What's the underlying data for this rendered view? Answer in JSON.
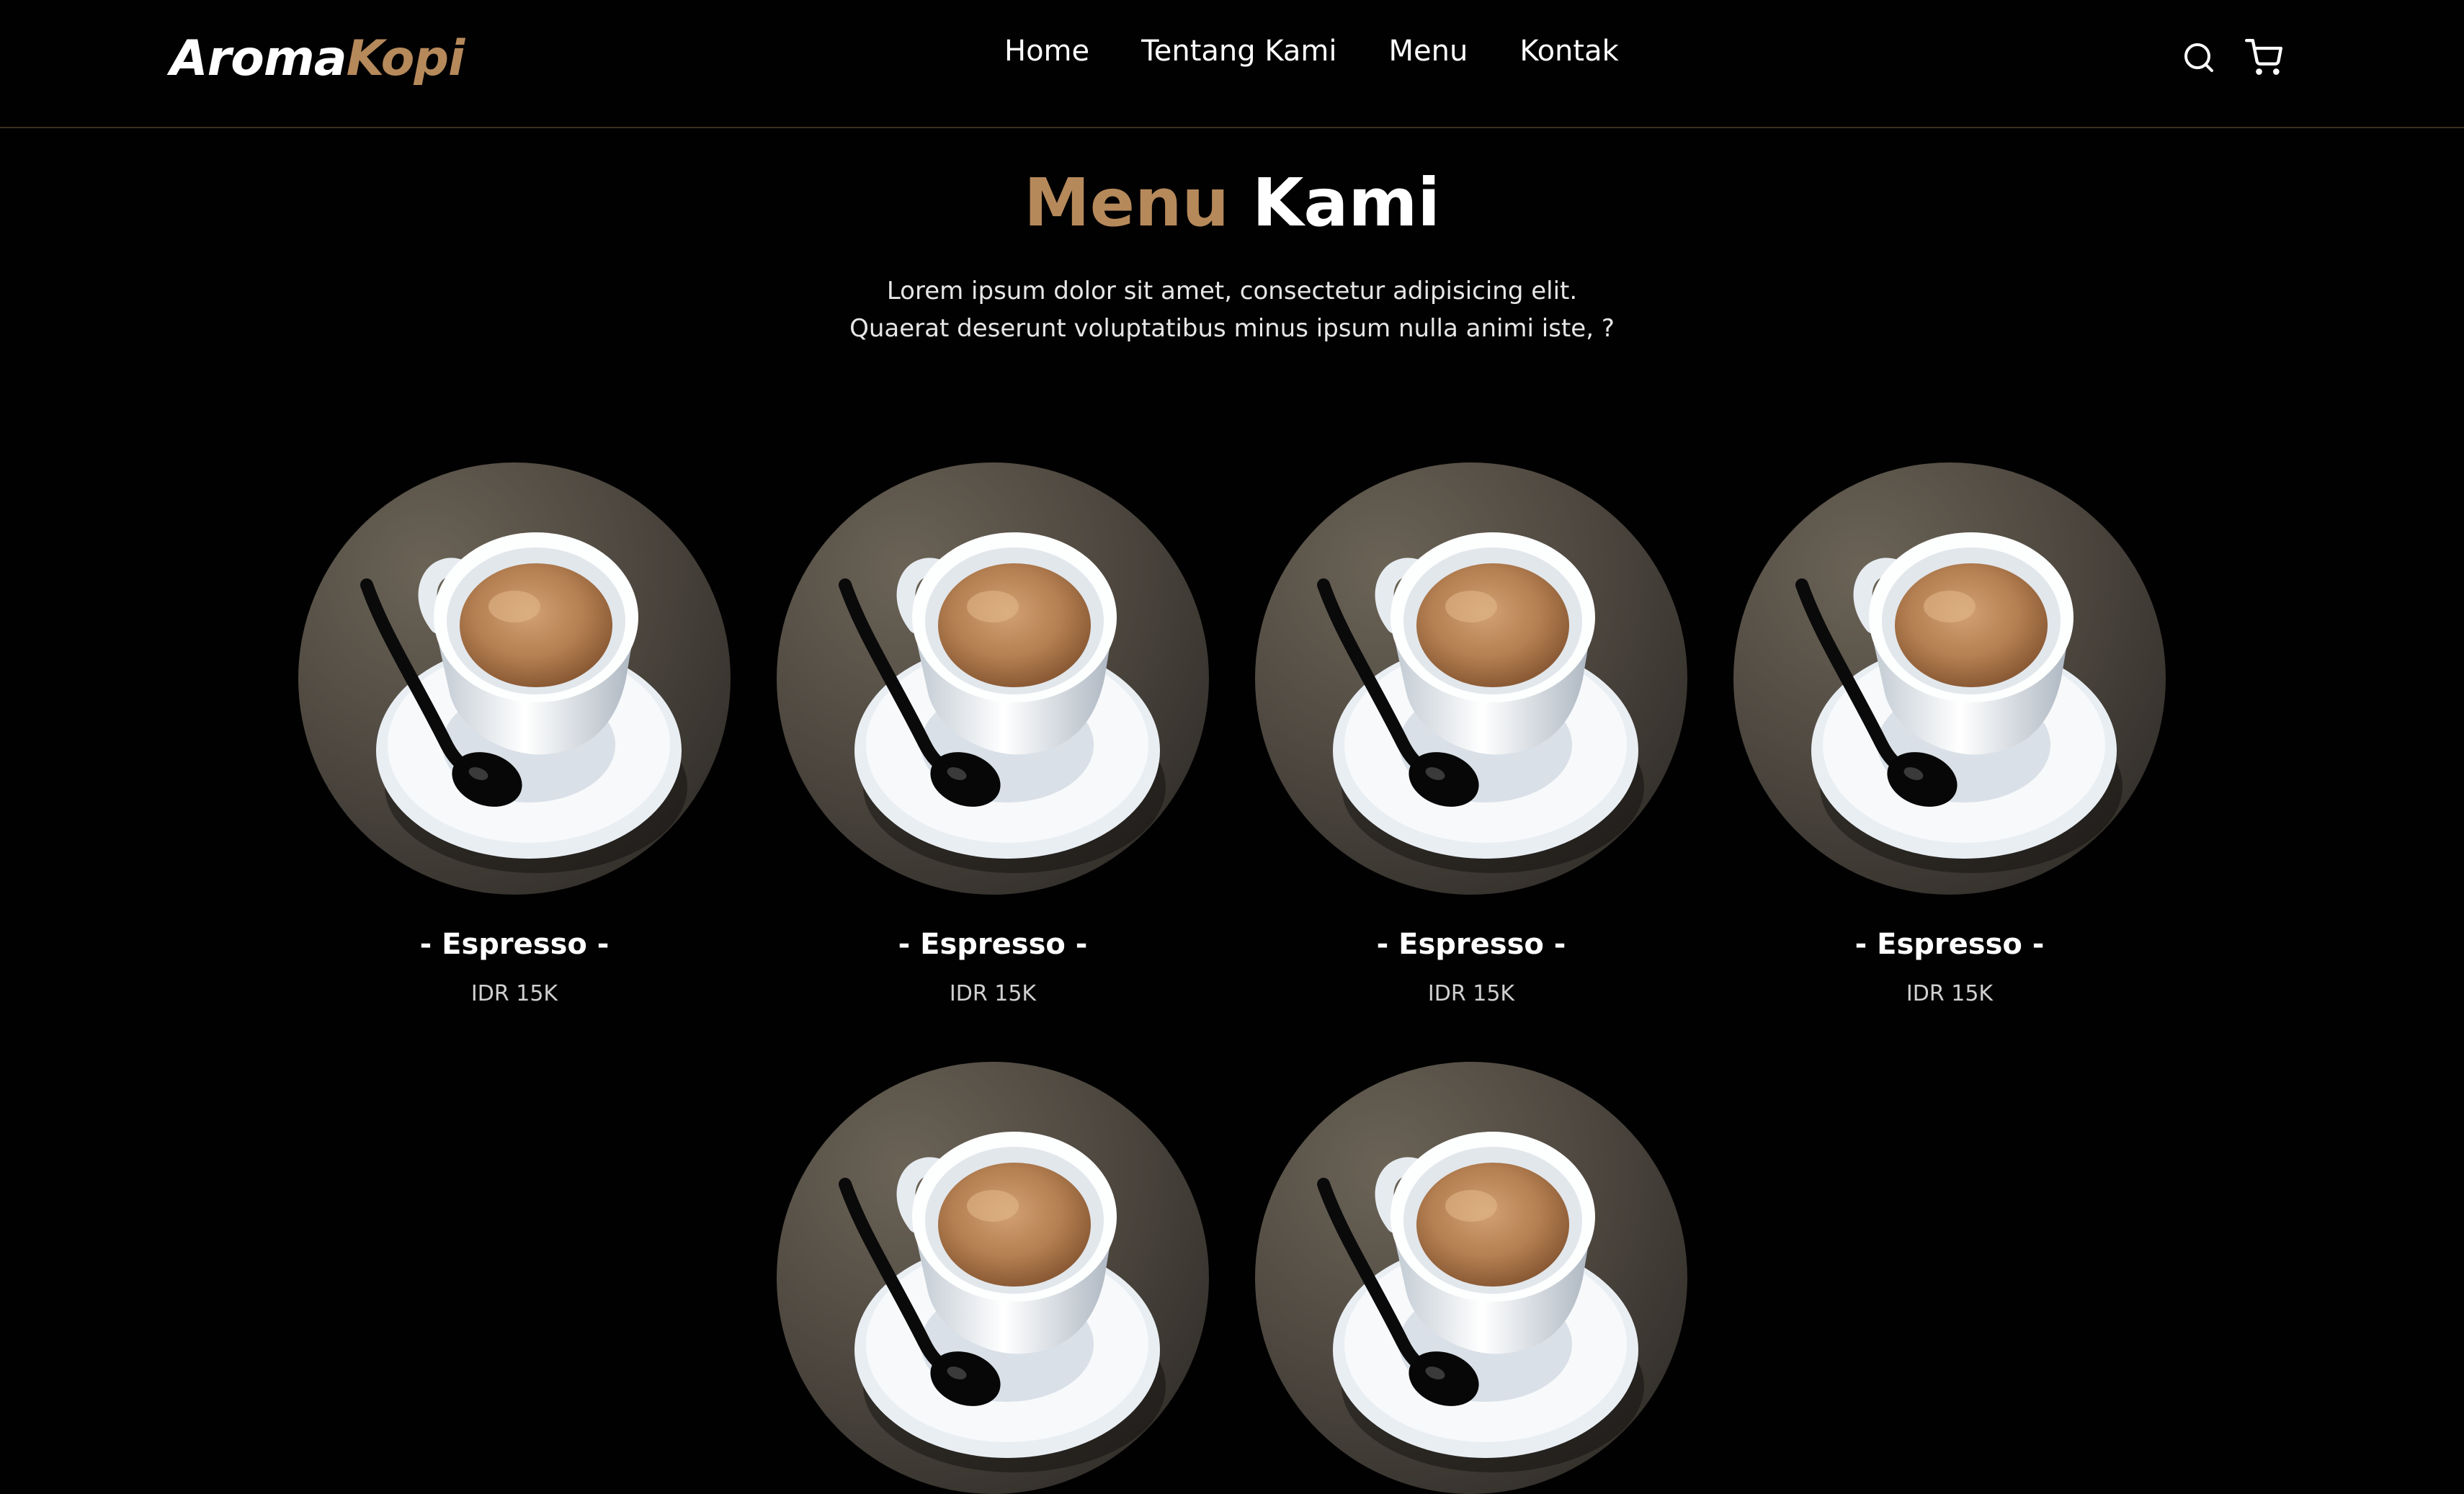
{
  "brand": {
    "part1": "Aroma",
    "part2": "Kopi"
  },
  "nav": {
    "links": [
      "Home",
      "Tentang Kami",
      "Menu",
      "Kontak"
    ],
    "icons": [
      "search-icon",
      "cart-icon"
    ]
  },
  "section": {
    "title_accent": "Menu",
    "title_rest": "Kami",
    "description_line1": "Lorem ipsum dolor sit amet, consectetur adipisicing elit.",
    "description_line2": "Quaerat deserunt voluptatibus minus ipsum nulla animi iste, ?"
  },
  "menu_items": [
    {
      "name": "- Espresso -",
      "price": "IDR 15K"
    },
    {
      "name": "- Espresso -",
      "price": "IDR 15K"
    },
    {
      "name": "- Espresso -",
      "price": "IDR 15K"
    },
    {
      "name": "- Espresso -",
      "price": "IDR 15K"
    },
    {
      "name": "- Espresso -",
      "price": ""
    },
    {
      "name": "- Espresso -",
      "price": ""
    }
  ],
  "colors": {
    "background": "#010101",
    "accent": "#b6895b",
    "text": "#ffffff"
  }
}
